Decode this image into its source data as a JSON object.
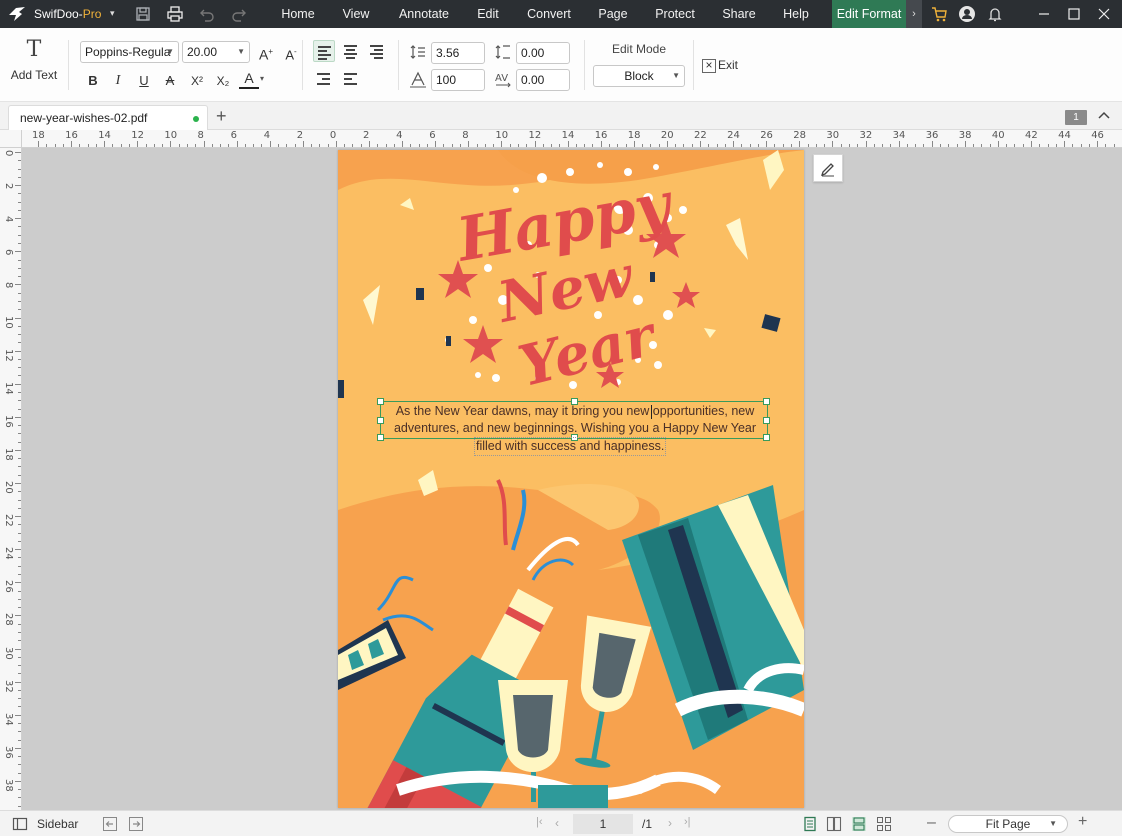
{
  "app": {
    "brand_name": "SwifDoo-",
    "brand_pro": "Pro",
    "brand_caret": "▾"
  },
  "menu": {
    "items": [
      "Home",
      "View",
      "Annotate",
      "Edit",
      "Convert",
      "Page",
      "Protect",
      "Share",
      "Help",
      "Edit Format"
    ],
    "active": "Edit Format",
    "more": "›"
  },
  "ribbon": {
    "add_text_icon": "T",
    "add_text_label": "Add Text",
    "font_family": "Poppins-Regula",
    "font_size": "20.00",
    "bold": "B",
    "italic": "I",
    "underline": "U",
    "strike": "A",
    "superscript": "X²",
    "subscript": "X₂",
    "font_color": "A",
    "line_spacing": "3.56",
    "paragraph_spacing": "0.00",
    "scale": "100",
    "char_spacing": "0.00",
    "edit_mode_label": "Edit Mode",
    "edit_mode_value": "Block",
    "exit_label": "Exit",
    "accent_color": "#2f7a55"
  },
  "tabs": {
    "documents": [
      {
        "name": "new-year-wishes-02.pdf",
        "modified": true
      }
    ],
    "add_tab": "+",
    "page_badge": "1"
  },
  "rulers": {
    "horizontal": [
      "18",
      "16",
      "14",
      "12",
      "10",
      "8",
      "6",
      "4",
      "2",
      "0",
      "2",
      "4",
      "6",
      "8",
      "10",
      "12",
      "14",
      "16",
      "18",
      "20",
      "22",
      "24",
      "26",
      "28",
      "30",
      "32",
      "34",
      "36",
      "38",
      "40",
      "42",
      "44",
      "46"
    ],
    "vertical": [
      "0",
      "2",
      "4",
      "6",
      "8",
      "10",
      "12",
      "14",
      "16",
      "18",
      "20",
      "22",
      "24",
      "26",
      "28",
      "30",
      "32",
      "34",
      "36",
      "38"
    ]
  },
  "document": {
    "title_art": [
      "Happy",
      "New",
      "Year"
    ],
    "paragraph_lines": [
      "As the New Year dawns, may it bring you new opportunities, new",
      "adventures, and new beginnings. Wishing you a Happy New Year",
      "filled with success and happiness."
    ],
    "background_color": "#fbbe62",
    "title_color": "#e05050",
    "bottle_color": "#2e9a9a",
    "text_color": "#4a2f27"
  },
  "statusbar": {
    "sidebar_label": "Sidebar",
    "current_page": "1",
    "total_pages": "/1",
    "zoom_mode": "Fit Page"
  }
}
